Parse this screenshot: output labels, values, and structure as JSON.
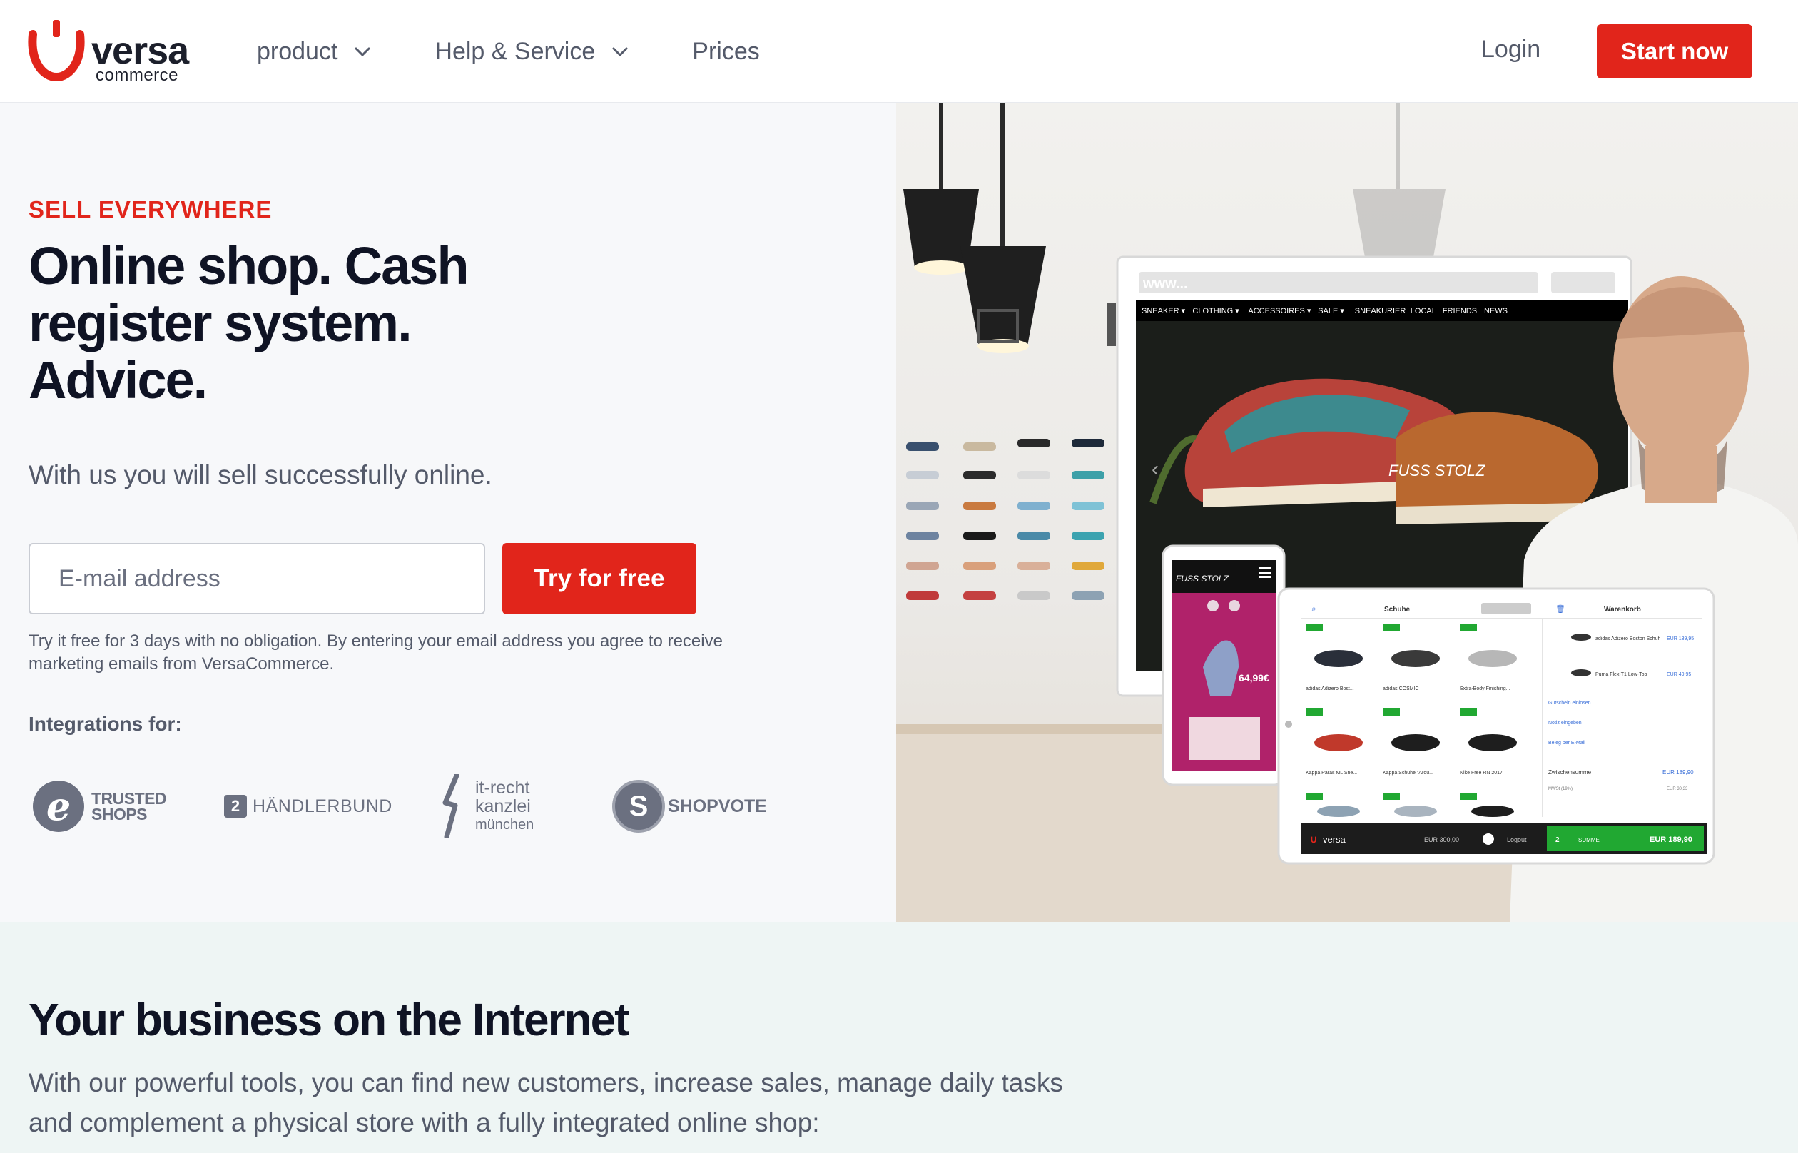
{
  "header": {
    "logo": {
      "word": "versa",
      "sub": "commerce"
    },
    "nav": [
      {
        "label": "product",
        "has_dropdown": true
      },
      {
        "label": "Help & Service",
        "has_dropdown": true
      },
      {
        "label": "Prices",
        "has_dropdown": false
      }
    ],
    "login_label": "Login",
    "start_label": "Start now"
  },
  "hero": {
    "eyebrow": "SELL EVERYWHERE",
    "headline": "Online shop. Cash register system. Advice.",
    "subline": "With us you will sell successfully online.",
    "email_placeholder": "E-mail address",
    "try_label": "Try for free",
    "disclaimer": "Try it free for 3 days with no obligation. By entering your email address you agree to receive marketing emails from VersaCommerce.",
    "integrations_label": "Integrations for:",
    "integrations": {
      "trusted_shops": {
        "mark": "e",
        "line1": "TRUSTED",
        "line2": "SHOPS"
      },
      "haendlerbund": {
        "mark": "2",
        "text": "HÄNDLERBUND"
      },
      "it_recht": {
        "line1": "it-recht",
        "line2": "kanzlei",
        "line3": "münchen"
      },
      "shopvote": {
        "mark": "S",
        "text": "SHOPVOTE"
      }
    },
    "image": {
      "browser_url": "www...",
      "shop_nav": [
        "SNEAKER ▾",
        "CLOTHING ▾",
        "ACCESSOIRES ▾",
        "SALE ▾",
        "SNEAKURIER",
        "LOCAL",
        "FRIENDS",
        "NEWS"
      ],
      "brand_text": "FUSS STOLZ",
      "phone_price": "64,99€",
      "pos": {
        "tab_shoes": "Schuhe",
        "tab_cart": "Warenkorb",
        "products": [
          "adidas Adizero Bost...",
          "adidas COSMIC",
          "Extra-Body Finishing...",
          "Kappa Paras ML Sne...",
          "Kappa Schuhe \"Arou...",
          "Nike Free RN 2017"
        ],
        "cart_items": [
          {
            "name": "adidas Adizero Boston Schuh",
            "price": "EUR 139,95"
          },
          {
            "name": "Puma Flex-T1 Low-Top",
            "price": "EUR 49,95"
          }
        ],
        "links": [
          "Gutschein einlösen",
          "Notiz eingeben",
          "Beleg per E-Mail"
        ],
        "subtotal_label": "Zwischensumme",
        "subtotal": "EUR 189,90",
        "tax_label": "MWSt (19%)",
        "tax": "EUR 30,33",
        "footer_logo": "versa",
        "footer_amount": "EUR 300,00",
        "logout": "Logout",
        "qty": "2",
        "sum_label": "SUMME",
        "total": "EUR 189,90"
      }
    }
  },
  "section2": {
    "title": "Your business on the Internet",
    "text": "With our powerful tools, you can find new customers, increase sales, manage daily tasks and complement a physical store with a fully integrated online shop:"
  },
  "colors": {
    "brand_red": "#e1251b",
    "heading": "#0f1324",
    "body_text": "#545a6a",
    "hero_bg": "#f7f8fa",
    "section2_bg": "#eef5f4"
  }
}
